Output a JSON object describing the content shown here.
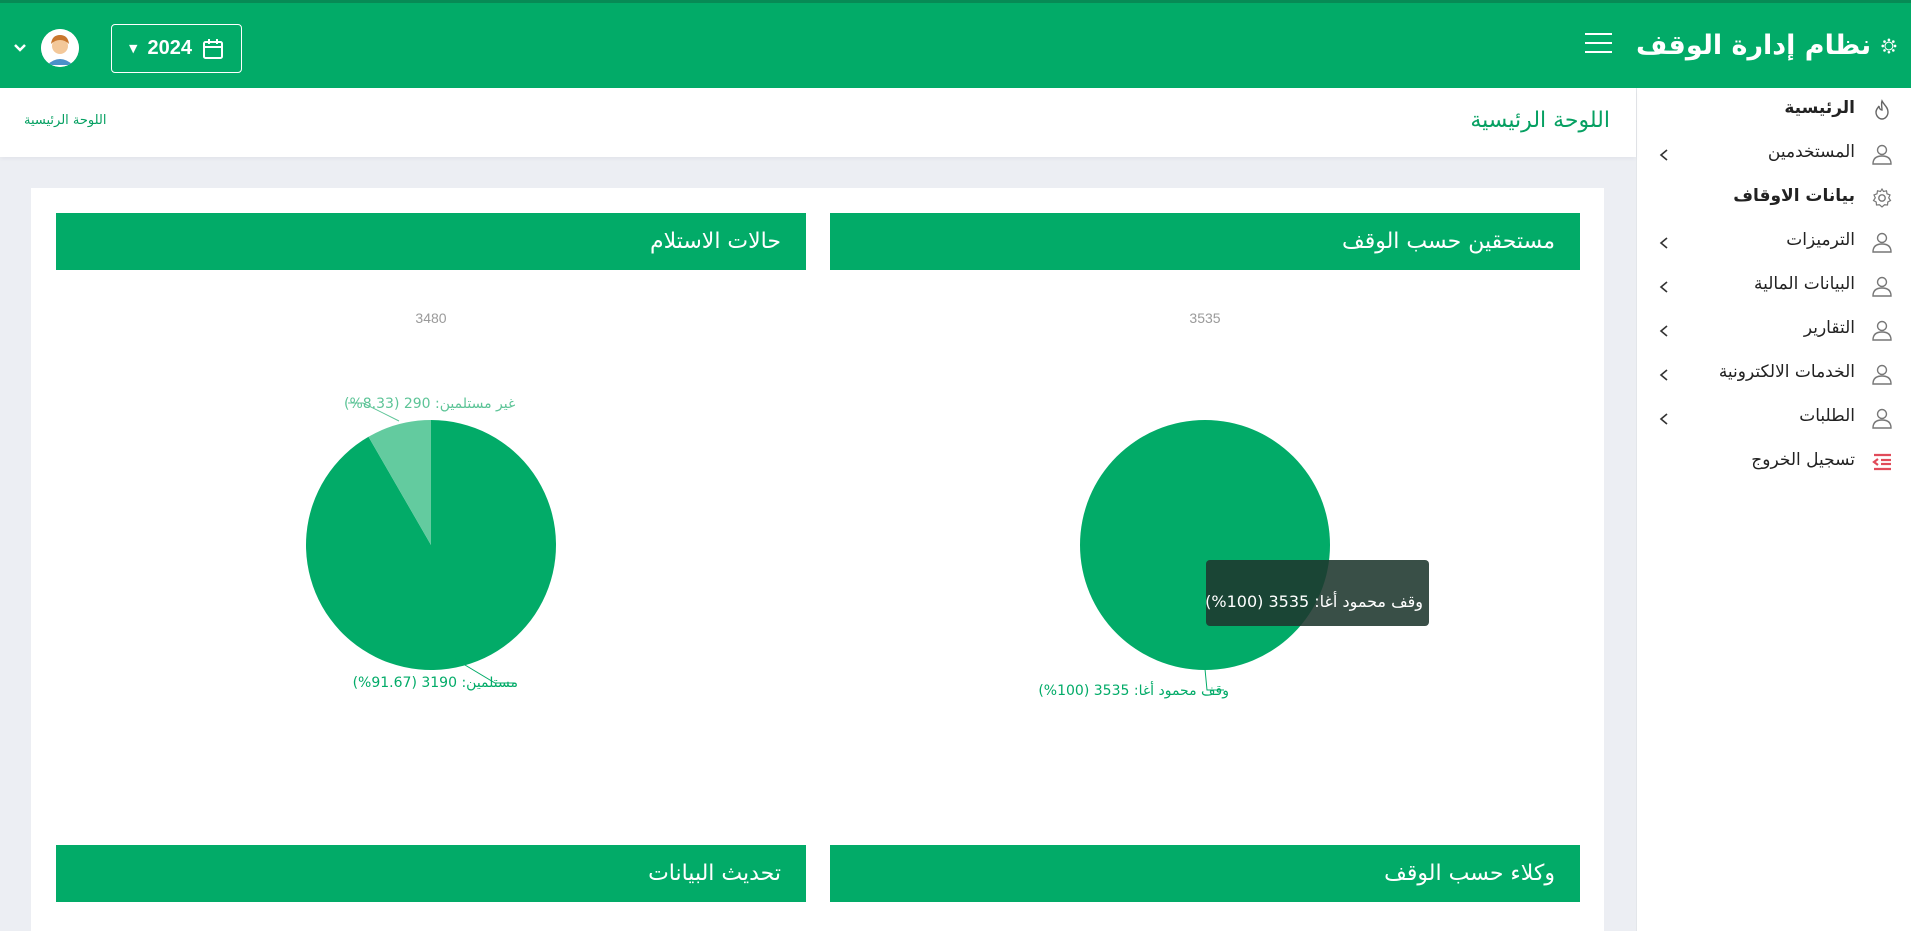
{
  "app": {
    "title": "نظام إدارة الوقف"
  },
  "header": {
    "year": "2024"
  },
  "page": {
    "title": "اللوحة الرئيسية",
    "breadcrumb": "اللوحة الرئيسية"
  },
  "sidebar": {
    "items": [
      {
        "label": "الرئيسية",
        "icon": "fire-icon",
        "has_submenu": false
      },
      {
        "label": "المستخدمين",
        "icon": "user-icon",
        "has_submenu": true
      },
      {
        "label": "بيانات الاوقاف",
        "icon": "gear-icon",
        "has_submenu": false
      },
      {
        "label": "الترميزات",
        "icon": "user-icon",
        "has_submenu": true
      },
      {
        "label": "البيانات المالية",
        "icon": "user-icon",
        "has_submenu": true
      },
      {
        "label": "التقارير",
        "icon": "user-icon",
        "has_submenu": true
      },
      {
        "label": "الخدمات الالكترونية",
        "icon": "user-icon",
        "has_submenu": true
      },
      {
        "label": "الطلبات",
        "icon": "user-icon",
        "has_submenu": true
      },
      {
        "label": "تسجيل الخروج",
        "icon": "logout-icon",
        "has_submenu": false
      }
    ]
  },
  "panels": {
    "beneficiaries": {
      "title": "مستحقين حسب الوقف"
    },
    "receipt": {
      "title": "حالات الاستلام"
    },
    "agents": {
      "title": "وكلاء حسب الوقف"
    },
    "data_update": {
      "title": "تحديث البيانات"
    }
  },
  "tooltip": {
    "text": "وقف محمود أغا: 3535 (100%)"
  },
  "colors": {
    "primary": "#02ab68",
    "slice_light": "#63cb9f",
    "label_light": "#5dc497",
    "total": "#9a9a9a",
    "logout": "#e14b5a"
  },
  "chart_data": [
    {
      "type": "pie",
      "total": "3535",
      "slices": [
        {
          "name": "وقف محمود أغا",
          "value": 3535,
          "percent": 100,
          "label": "وقف محمود أغا: 3535 (100%)"
        }
      ]
    },
    {
      "type": "pie",
      "total": "3480",
      "slices": [
        {
          "name": "مستلمين",
          "value": 3190,
          "percent": 91.67,
          "label": "مستلمين: 3190 (91.67%)"
        },
        {
          "name": "غير مستلمين",
          "value": 290,
          "percent": 8.33,
          "label": "غير مستلمين: 290 (8.33%)"
        }
      ]
    }
  ]
}
